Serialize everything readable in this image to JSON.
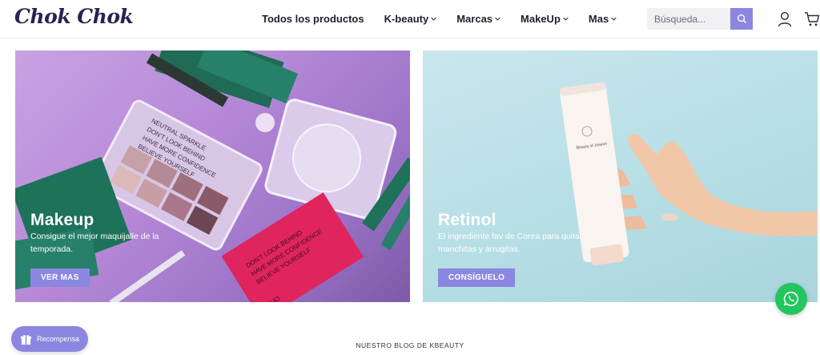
{
  "brand": {
    "logo_text": "Chok Chok"
  },
  "nav": {
    "items": [
      {
        "label": "Todos los productos",
        "dropdown": false
      },
      {
        "label": "K-beauty",
        "dropdown": true
      },
      {
        "label": "Marcas",
        "dropdown": true
      },
      {
        "label": "MakeUp",
        "dropdown": true
      },
      {
        "label": "Mas",
        "dropdown": true
      }
    ]
  },
  "search": {
    "placeholder": "Búsqueda..."
  },
  "colors": {
    "accent": "#8b86e0",
    "whatsapp": "#22c55e",
    "logo": "#2a2350"
  },
  "banners": [
    {
      "title": "Makeup",
      "subtitle": "Consigue el mejor maquijalle de la temporada.",
      "button": "VER MAS"
    },
    {
      "title": "Retinol",
      "subtitle": "El ingrediente fav de Corea para quitar manchitas y arrugitas.",
      "button": "CONSÍGUELO"
    }
  ],
  "banner_art_text": {
    "palette_line1": "NEUTRAL SPARKLE",
    "palette_line2": "DON'T LOOK BEHIND",
    "palette_line3": "HAVE MORE CONFIDENCE",
    "palette_line4": "BELIEVE YOURSELF",
    "brand_mark": "CLIO",
    "tube_brand": "Beauty of Joseon"
  },
  "reward": {
    "label": "Recompensa"
  },
  "blog": {
    "heading": "NUESTRO BLOG DE KBEAUTY"
  }
}
